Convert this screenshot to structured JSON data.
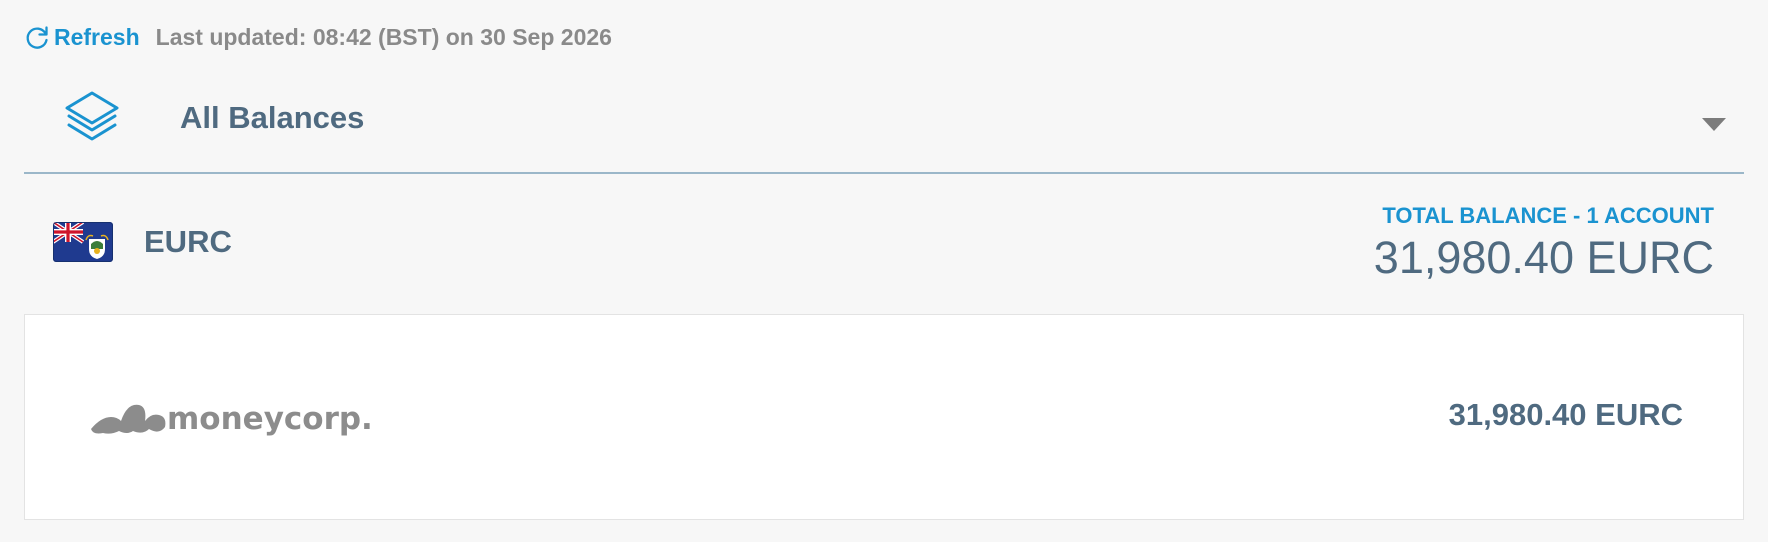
{
  "refresh": {
    "label": "Refresh",
    "icon": "refresh-icon",
    "last_updated": "Last updated: 08:42 (BST) on 30 Sep 2026"
  },
  "selector": {
    "title": "All Balances",
    "icon": "layers-icon",
    "chevron_icon": "chevron-down-icon"
  },
  "currency": {
    "code": "EURC",
    "flag_icon": "ascension-island-flag-icon",
    "total_label": "TOTAL BALANCE - 1 ACCOUNT",
    "total_value": "31,980.40 EURC"
  },
  "accounts": [
    {
      "provider": "moneycorp.",
      "balance": "31,980.40 EURC"
    }
  ],
  "colors": {
    "accent_blue": "#1a93d0",
    "heading_slate": "#4f6a80",
    "muted_gray": "#8a8a8a",
    "background": "#f7f7f7"
  }
}
